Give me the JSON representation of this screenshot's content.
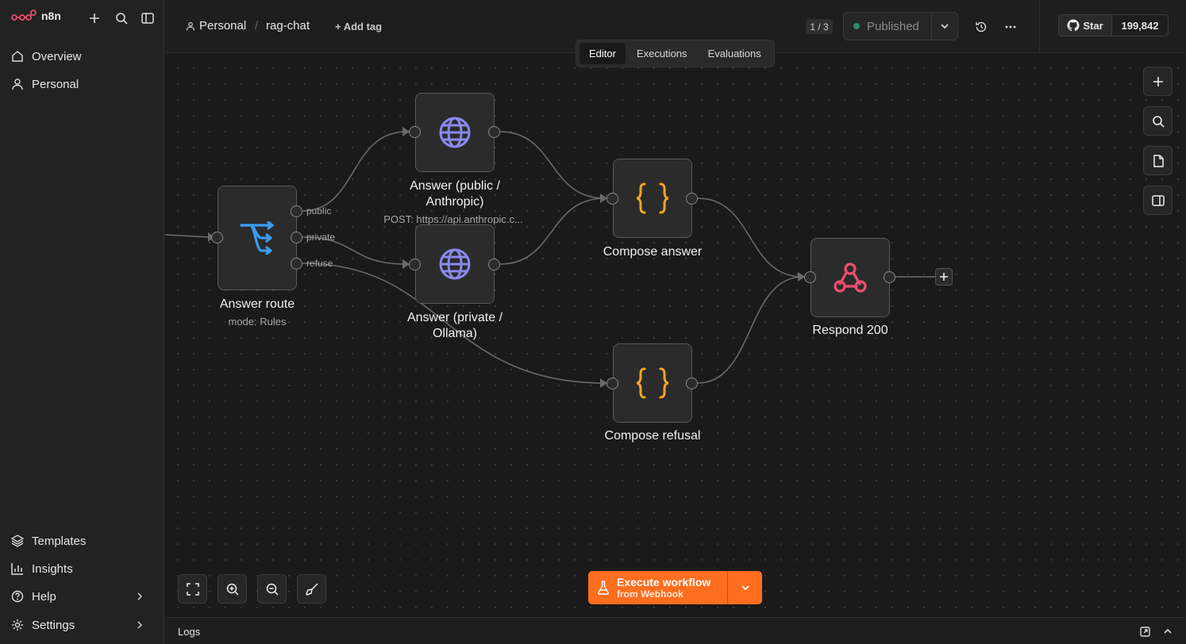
{
  "app": {
    "name": "n8n"
  },
  "sidebar": {
    "top_items": [
      {
        "label": "Overview",
        "icon": "home-icon"
      },
      {
        "label": "Personal",
        "icon": "user-icon"
      }
    ],
    "bottom_items": [
      {
        "label": "Templates",
        "icon": "templates-icon"
      },
      {
        "label": "Insights",
        "icon": "insights-icon"
      },
      {
        "label": "Help",
        "icon": "help-icon"
      },
      {
        "label": "Settings",
        "icon": "gear-icon"
      }
    ]
  },
  "header": {
    "breadcrumb_project": "Personal",
    "workflow_name": "rag-chat",
    "add_tag": "+ Add tag",
    "page_counter": "1 / 3",
    "publish_label": "Published",
    "github_star": "Star",
    "github_count": "199,842"
  },
  "tabs": [
    {
      "label": "Editor",
      "active": true
    },
    {
      "label": "Executions",
      "active": false
    },
    {
      "label": "Evaluations",
      "active": false
    }
  ],
  "nodes": {
    "answer_route": {
      "label": "Answer route",
      "subtitle": "mode: Rules",
      "outputs": [
        "public",
        "private",
        "refuse"
      ]
    },
    "answer_public": {
      "label_line1": "Answer (public /",
      "label_line2": "Anthropic)",
      "subtitle": "POST: https://api.anthropic.c..."
    },
    "answer_private": {
      "label_line1": "Answer (private /",
      "label_line2": "Ollama)"
    },
    "compose_answer": {
      "label": "Compose answer"
    },
    "compose_refusal": {
      "label": "Compose refusal"
    },
    "respond": {
      "label": "Respond 200"
    }
  },
  "execute": {
    "title": "Execute workflow",
    "subtitle": "from Webhook"
  },
  "logs": {
    "label": "Logs"
  },
  "colors": {
    "accent": "#ff6d1f",
    "route_icon": "#3b9cf2",
    "http_icon": "#8a8af0",
    "code_icon": "#f5a623",
    "webhook_icon": "#ee4f6d"
  }
}
